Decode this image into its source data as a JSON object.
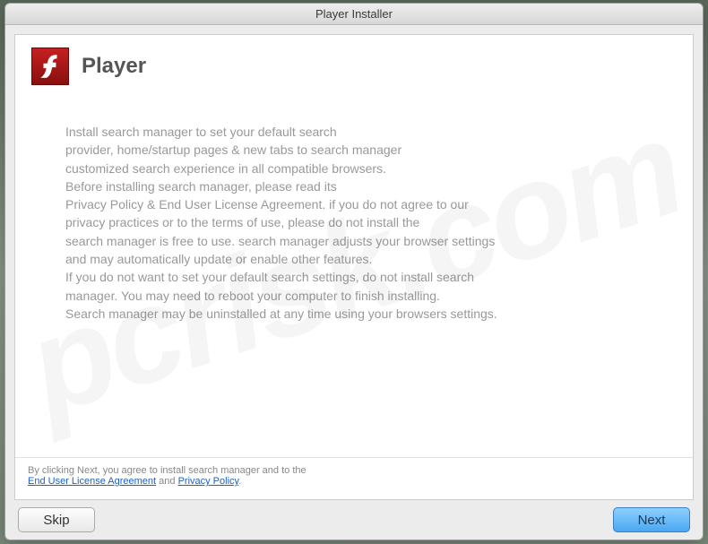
{
  "window": {
    "title": "Player Installer"
  },
  "header": {
    "app_name": "Player"
  },
  "body": {
    "line1": "Install search manager to set your default search",
    "line2": "provider, home/startup pages & new tabs to search manager",
    "line3": "customized search experience in all compatible browsers.",
    "line4": "Before installing search manager, please read its",
    "line5": "Privacy Policy & End User License Agreement. if you do not agree to our",
    "line6": "privacy practices or to the terms of use, please do not install the",
    "line7": "search manager is free to use. search manager adjusts your browser settings",
    "line8": "and may automatically update or enable other features.",
    "line9": "If you do not want to set your default search settings, do not install search",
    "line10": "manager. You may need to reboot your computer to finish installing.",
    "line11": "Search manager may be uninstalled at any time using your browsers settings."
  },
  "footer": {
    "pretext": "By clicking Next, you agree to install search manager and to the",
    "link1": "End User License Agreement",
    "and": " and ",
    "link2": "Privacy Policy",
    "period": "."
  },
  "buttons": {
    "skip": "Skip",
    "next": "Next"
  },
  "watermark": "pcrisk.com"
}
